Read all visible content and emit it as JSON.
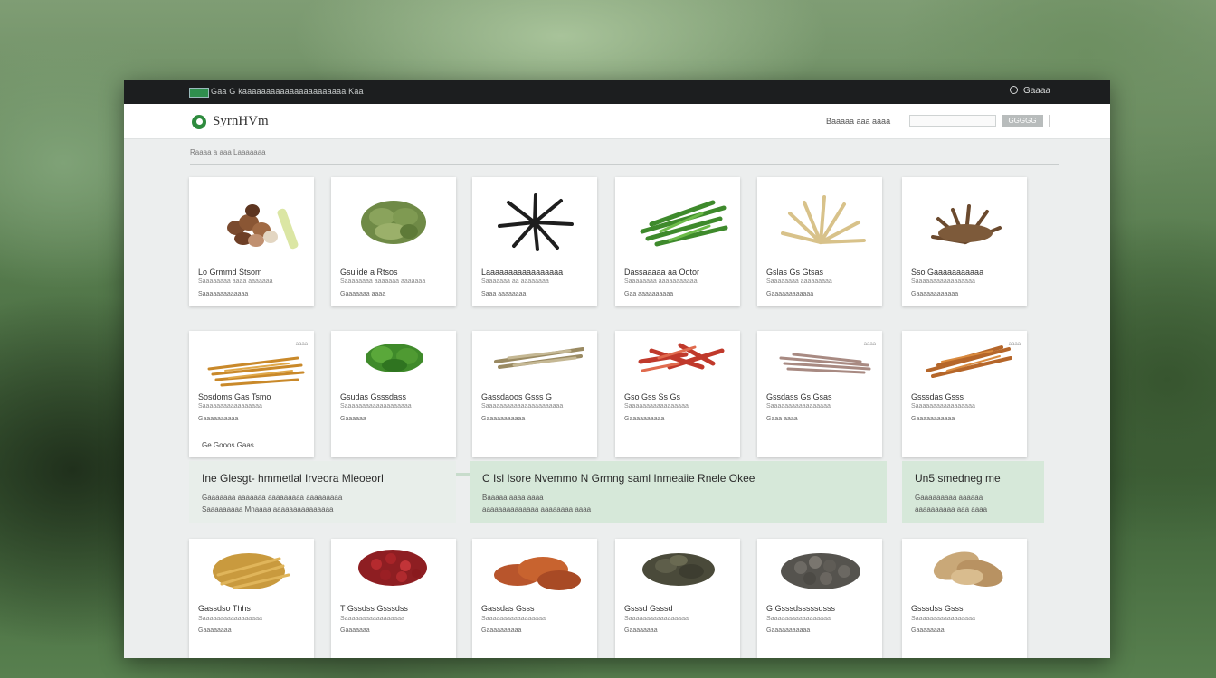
{
  "topbar": {
    "crumb": "Gaa G  kaaaaaaaaaaaaaaaaaaaaaa  Kaa",
    "account": "Gaaaa"
  },
  "header": {
    "logo": "SyrnHVm",
    "search_label": "Baaaaa aaa aaaa",
    "search_placeholder": "",
    "search_button": "GGGGG"
  },
  "breadcrumb": "Raaaa  a  aaa  Laaaaaaa",
  "cards": [
    {
      "title": "Lo Grmmd Stsom",
      "desc": "Saaaaaaaa aaaa aaaaaaa",
      "meta": "Saaaaaaaaaaaaa",
      "tag": ""
    },
    {
      "title": "Gsulide a Rtsos",
      "desc": "Saaaaaaaa aaaaaaa aaaaaaa",
      "meta": "Gaaaaaaa aaaa",
      "tag": ""
    },
    {
      "title": "Laaaaaaaaaaaaaaaaa",
      "desc": "Saaaaaaa aa aaaaaaaa",
      "meta": "Saaa aaaaaaaa",
      "tag": ""
    },
    {
      "title": "Dassaaaaa aa Ootor",
      "desc": "Saaaaaaaa aaaaaaaaaaa",
      "meta": "Gaa aaaaaaaaaa",
      "tag": ""
    },
    {
      "title": "Gslas Gs Gtsas",
      "desc": "Saaaaaaaa aaaaaaaaa",
      "meta": "Gaaaaaaaaaaaa",
      "tag": ""
    },
    {
      "title": "Sso Gaaaaaaaaaaa",
      "desc": "Saaaaaaaaaaaaaaaaa",
      "meta": "Gaaaaaaaaaaaa",
      "tag": ""
    },
    {
      "title": "Sosdoms Gas Tsmo",
      "desc": "Saaaaaaaaaaaaaaaaa",
      "meta": "Gaaaaaaaaaa",
      "tag": "aaaa",
      "extra": "Ge Gooos Gaas"
    },
    {
      "title": "Gsudas Gsssdass",
      "desc": "Saaaaaaaaaaaaaaaaaaa",
      "meta": "Gaaaaaa",
      "tag": ""
    },
    {
      "title": "Gassdaoos Gsss G",
      "desc": "Saaaaaaaaaaaaaaaaaaaaaa",
      "meta": "Gaaaaaaaaaaa",
      "tag": ""
    },
    {
      "title": "Gso Gss Ss Gs",
      "desc": "Saaaaaaaaaaaaaaaaa",
      "meta": "Gaaaaaaaaaa",
      "tag": ""
    },
    {
      "title": "Gssdass Gs Gsas",
      "desc": "Saaaaaaaaaaaaaaaaa",
      "meta": "Gaaa aaaa",
      "tag": "aaaa"
    },
    {
      "title": "Gsssdas Gsss",
      "desc": "Saaaaaaaaaaaaaaaaa",
      "meta": "Gaaaaaaaaaaa",
      "tag": "aaaa"
    },
    {
      "title": "Gassdso Thhs",
      "desc": "Saaaaaaaaaaaaaaaaa",
      "meta": "Gaaaaaaaa",
      "tag": ""
    },
    {
      "title": "T Gssdss Gsssdss",
      "desc": "Saaaaaaaaaaaaaaaaa",
      "meta": "Gaaaaaaa",
      "tag": ""
    },
    {
      "title": "Gassdas Gsss",
      "desc": "Saaaaaaaaaaaaaaaaa",
      "meta": "Gaaaaaaaaaa",
      "tag": ""
    },
    {
      "title": "Gsssd Gsssd",
      "desc": "Saaaaaaaaaaaaaaaaa",
      "meta": "Gaaaaaaaa",
      "tag": ""
    },
    {
      "title": "G Gsssdsssssdsss",
      "desc": "Saaaaaaaaaaaaaaaaa",
      "meta": "Gaaaaaaaaaaa",
      "tag": ""
    },
    {
      "title": "Gsssdss Gsss",
      "desc": "Saaaaaaaaaaaaaaaaa",
      "meta": "Gaaaaaaaa",
      "tag": ""
    }
  ],
  "banners": [
    {
      "title": "Ine Glesgt- hmmetlal Irveora Mleoeorl",
      "line1": "Gaaaaaaa aaaaaaa aaaaaaaaa aaaaaaaaa",
      "line2": "Saaaaaaaaa Mnaaaa aaaaaaaaaaaaaaa"
    },
    {
      "title": "C Isl Isore Nvemmo N Grmng saml Inmeaiie Rnele Okee",
      "line1": "Baaaaa aaaa aaaa",
      "line2": "aaaaaaaaaaaaaa aaaaaaaa aaaa"
    },
    {
      "title": "Un5 smedneg me",
      "line1": "Gaaaaaaaaa aaaaaa",
      "line2": "aaaaaaaaaa aaa aaaa"
    }
  ],
  "colors": {
    "brand": "#2e8b3e",
    "banner": "#d5e8d8",
    "topbar": "#1c1e1f"
  },
  "icons": {
    "logo": "leaf-logo-icon",
    "account": "user-icon"
  }
}
